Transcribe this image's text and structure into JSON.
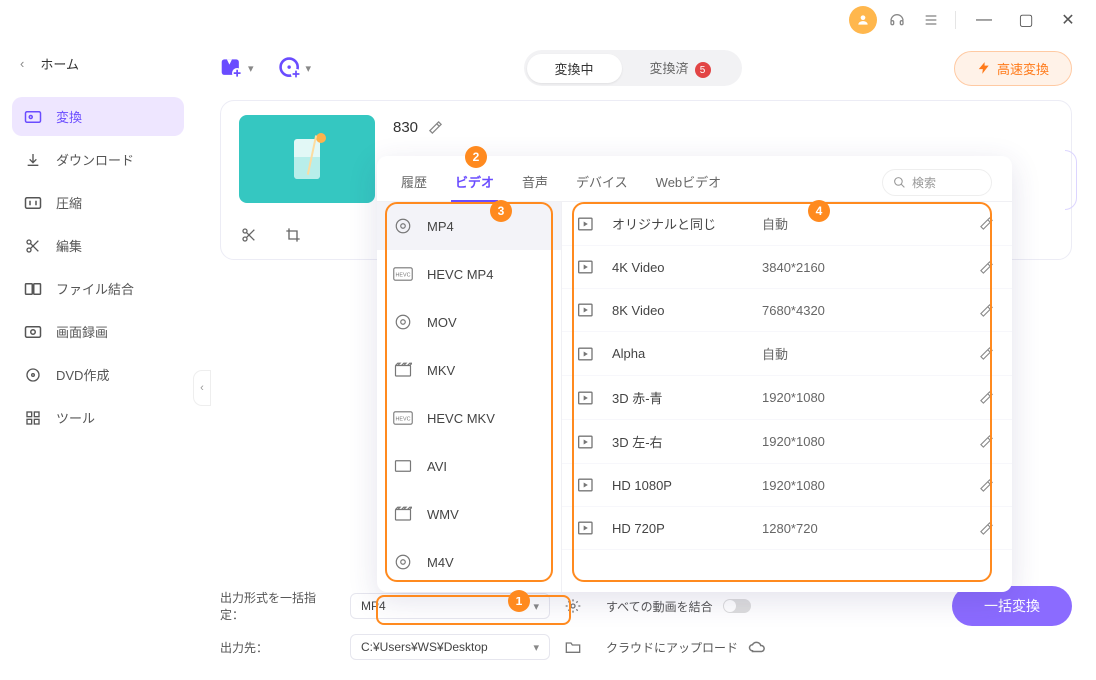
{
  "titlebar": {
    "minimize": "—",
    "maximize": "▢",
    "close": "✕"
  },
  "home_label": "ホーム",
  "sidebar": {
    "items": [
      {
        "label": "変換"
      },
      {
        "label": "ダウンロード"
      },
      {
        "label": "圧縮"
      },
      {
        "label": "編集"
      },
      {
        "label": "ファイル結合"
      },
      {
        "label": "画面録画"
      },
      {
        "label": "DVD作成"
      },
      {
        "label": "ツール"
      }
    ]
  },
  "top": {
    "tab_converting": "変換中",
    "tab_done": "変換済",
    "done_badge": "5",
    "fast_label": "高速変換"
  },
  "file": {
    "title": "830"
  },
  "popup": {
    "tabs": {
      "history": "履歴",
      "video": "ビデオ",
      "audio": "音声",
      "device": "デバイス",
      "web": "Webビデオ"
    },
    "search_placeholder": "検索",
    "formats": [
      "MP4",
      "HEVC MP4",
      "MOV",
      "MKV",
      "HEVC MKV",
      "AVI",
      "WMV",
      "M4V"
    ],
    "resolutions": [
      {
        "name": "オリジナルと同じ",
        "res": "自動"
      },
      {
        "name": "4K Video",
        "res": "3840*2160"
      },
      {
        "name": "8K Video",
        "res": "7680*4320"
      },
      {
        "name": "Alpha",
        "res": "自動"
      },
      {
        "name": "3D 赤-青",
        "res": "1920*1080"
      },
      {
        "name": "3D 左-右",
        "res": "1920*1080"
      },
      {
        "name": "HD 1080P",
        "res": "1920*1080"
      },
      {
        "name": "HD 720P",
        "res": "1280*720"
      }
    ]
  },
  "bottom": {
    "format_label": "出力形式を一括指定：",
    "format_value": "MP4",
    "merge_label": "すべての動画を結合",
    "dest_label": "出力先：",
    "dest_value": "C:¥Users¥WS¥Desktop",
    "cloud_label": "クラウドにアップロード",
    "convert_label": "一括変換"
  },
  "callouts": {
    "n1": "1",
    "n2": "2",
    "n3": "3",
    "n4": "4"
  }
}
